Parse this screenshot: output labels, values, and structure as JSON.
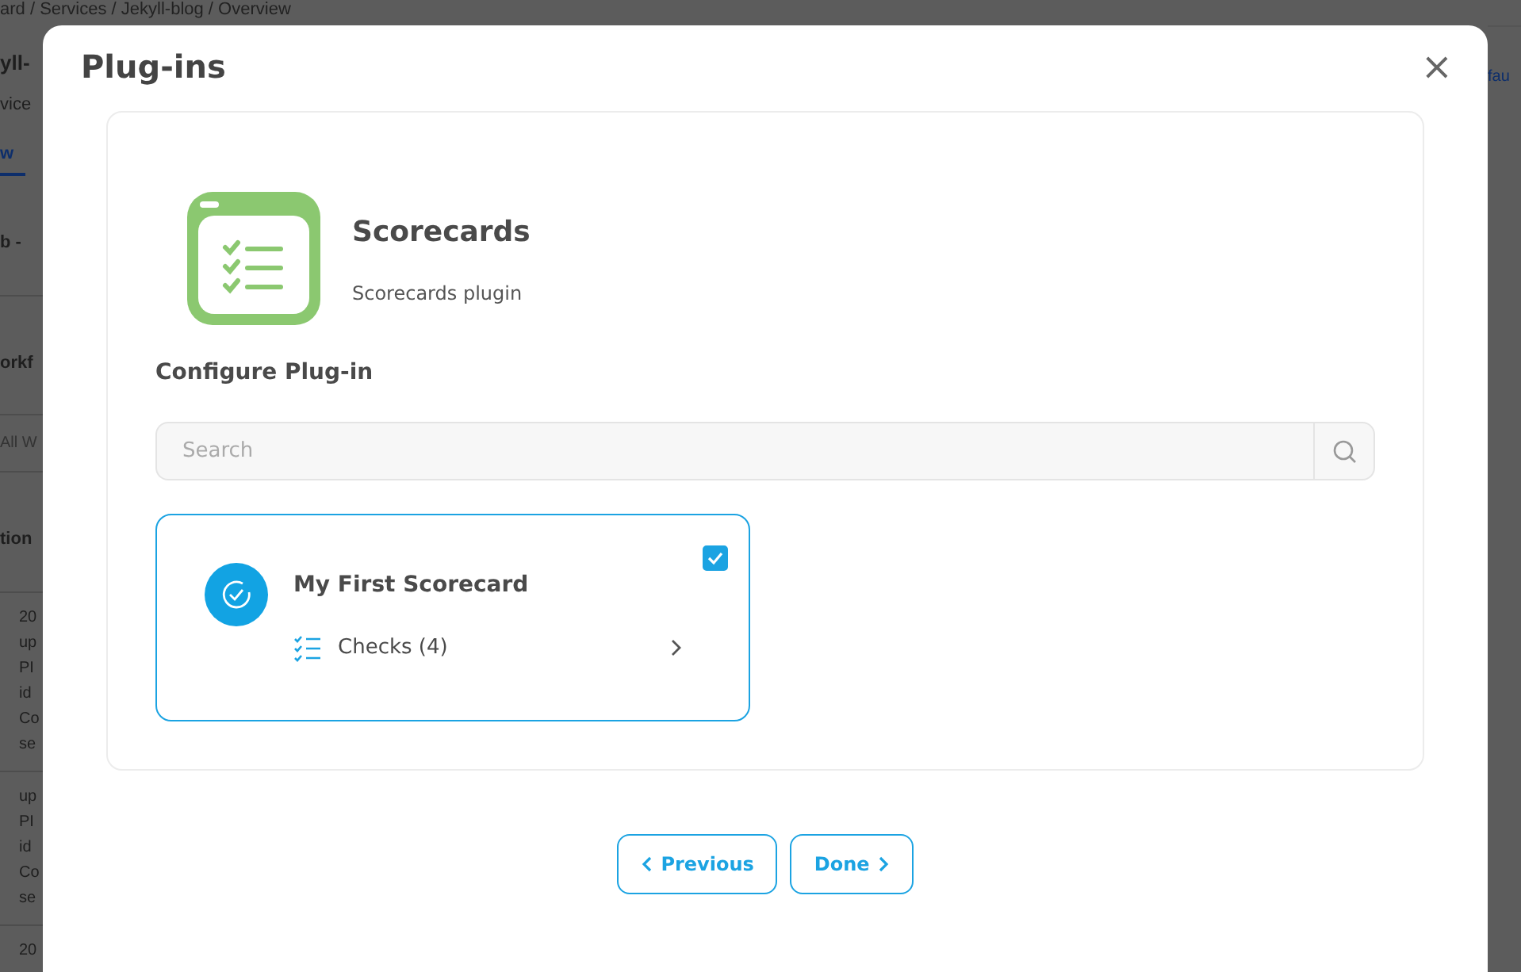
{
  "background_page": {
    "breadcrumb": "ard / Services / Jekyll-blog / Overview",
    "right_fragment": "fau",
    "left_fragments": [
      {
        "kind": "title",
        "text": "yll-"
      },
      {
        "kind": "subtitle",
        "text": "vice"
      },
      {
        "kind": "tab",
        "text": "w",
        "selected": true
      },
      {
        "kind": "heading",
        "text": "b -"
      },
      {
        "kind": "heading",
        "text": "orkf"
      },
      {
        "kind": "muted",
        "text": "All W"
      },
      {
        "kind": "heading",
        "text": "tion"
      },
      {
        "kind": "entry",
        "lines": [
          "20",
          "up",
          "PI",
          "id",
          "Co",
          "se"
        ]
      },
      {
        "kind": "entry",
        "lines": [
          "up",
          "PI",
          "id",
          "Co",
          "se"
        ]
      },
      {
        "kind": "entry",
        "lines": [
          "20"
        ]
      }
    ]
  },
  "modal": {
    "title": "Plug-ins",
    "close": "×",
    "plugin": {
      "name": "Scorecards",
      "description": "Scorecards plugin"
    },
    "section_title": "Configure Plug-in",
    "search": {
      "placeholder": "Search"
    },
    "scorecards": [
      {
        "name": "My First Scorecard",
        "checked": true,
        "checks_label": "Checks (4)"
      }
    ],
    "buttons": [
      {
        "label": "Previous",
        "kind": "back"
      },
      {
        "label": "Done",
        "kind": "next"
      }
    ]
  }
}
